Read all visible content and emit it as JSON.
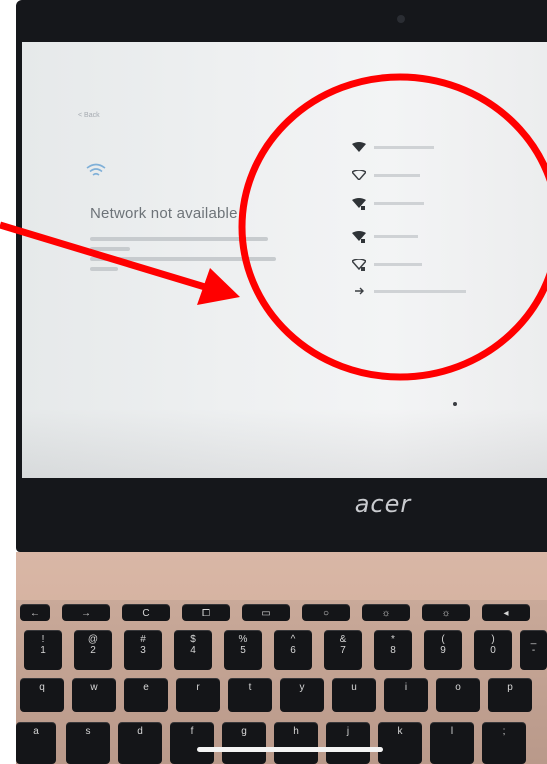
{
  "screen": {
    "back_label": "< Back",
    "title": "Network not available"
  },
  "laptop": {
    "brand": "acer"
  },
  "keyboard": {
    "fn_row": [
      "←",
      "→",
      "C",
      "⧠",
      "▭",
      "○",
      "☼",
      "☼",
      "◂"
    ],
    "number_row": [
      "!\n1",
      "@\n2",
      "#\n3",
      "$\n4",
      "%\n5",
      "^\n6",
      "&\n7",
      "*\n8",
      "(\n9",
      ")\n0",
      "_\n-"
    ],
    "letter_row": [
      "q",
      "w",
      "e",
      "r",
      "t",
      "y",
      "u",
      "i",
      "o",
      "p"
    ],
    "bottom_row": [
      "a",
      "s",
      "d",
      "f",
      "g",
      "h",
      "j",
      "k",
      "l",
      ";"
    ]
  },
  "annotation": {
    "circle_color": "#ff0000",
    "arrow_color": "#ff0000"
  }
}
